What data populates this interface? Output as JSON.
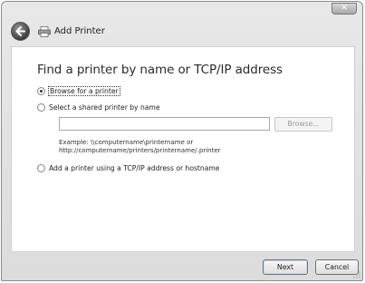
{
  "window": {
    "close_label": "✕"
  },
  "header": {
    "title": "Add Printer"
  },
  "main": {
    "heading": "Find a printer by name or TCP/IP address",
    "options": [
      {
        "label": "Browse for a printer",
        "checked": true
      },
      {
        "label": "Select a shared printer by name",
        "checked": false
      },
      {
        "label": "Add a printer using a TCP/IP address or hostname",
        "checked": false
      }
    ],
    "shared_printer_input": {
      "value": "",
      "placeholder": ""
    },
    "browse_button_label": "Browse...",
    "example_line1": "Example: \\\\computername\\printername or",
    "example_line2": "http://computername/printers/printername/.printer"
  },
  "footer": {
    "next_label": "Next",
    "cancel_label": "Cancel"
  },
  "icons": {
    "back": "back-arrow-icon",
    "printer": "printer-icon",
    "close": "close-icon"
  }
}
